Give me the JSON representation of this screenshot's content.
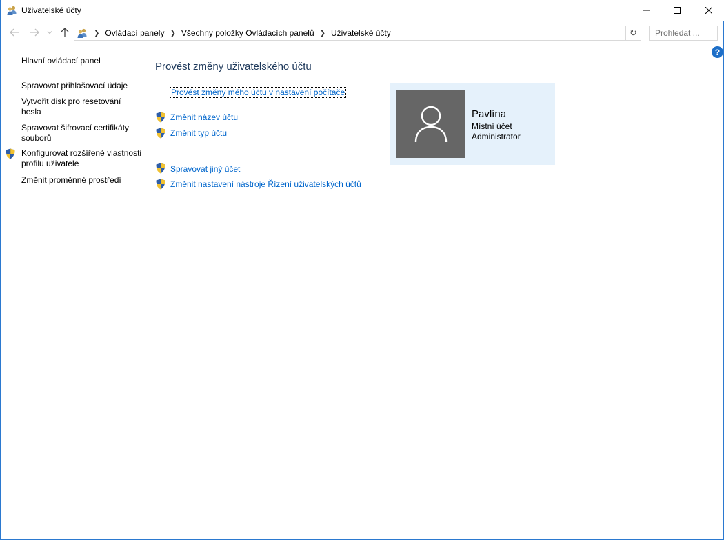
{
  "window": {
    "title": "Uživatelské účty",
    "app_icon": "users-icon",
    "controls": [
      "minimize-icon",
      "maximize-icon",
      "close-icon"
    ]
  },
  "addressbar": {
    "breadcrumbs": [
      "Ovládací panely",
      "Všechny položky Ovládacích panelů",
      "Uživatelské účty"
    ],
    "search_placeholder": "Prohledat ...",
    "refresh_icon": "refresh-icon"
  },
  "sidebar": {
    "items": [
      {
        "label": "Hlavní ovládací panel",
        "shield": false
      },
      {
        "label": "Spravovat přihlašovací údaje",
        "shield": false
      },
      {
        "label": "Vytvořit disk pro resetování hesla",
        "shield": false
      },
      {
        "label": "Spravovat šifrovací certifikáty souborů",
        "shield": false
      },
      {
        "label": "Konfigurovat rozšířené vlastnosti profilu uživatele",
        "shield": true
      },
      {
        "label": "Změnit proměnné prostředí",
        "shield": false
      }
    ]
  },
  "main": {
    "title": "Provést změny uživatelského účtu",
    "pc_settings_link": "Provést změny mého účtu v nastavení počítače",
    "tasks": [
      {
        "label": "Změnit název účtu",
        "shield": true
      },
      {
        "label": "Změnit typ účtu",
        "shield": true
      },
      {
        "label": "Spravovat jiný účet",
        "shield": true
      },
      {
        "label": "Změnit nastavení nástroje Řízení uživatelských účtů",
        "shield": true
      }
    ]
  },
  "account": {
    "name": "Pavlína",
    "type": "Místní účet",
    "role": "Administrator"
  },
  "colors": {
    "link": "#0066cc",
    "title": "#1e395b",
    "card_bg": "#e5f1fb",
    "avatar_bg": "#666666",
    "help": "#1e6fc8"
  }
}
